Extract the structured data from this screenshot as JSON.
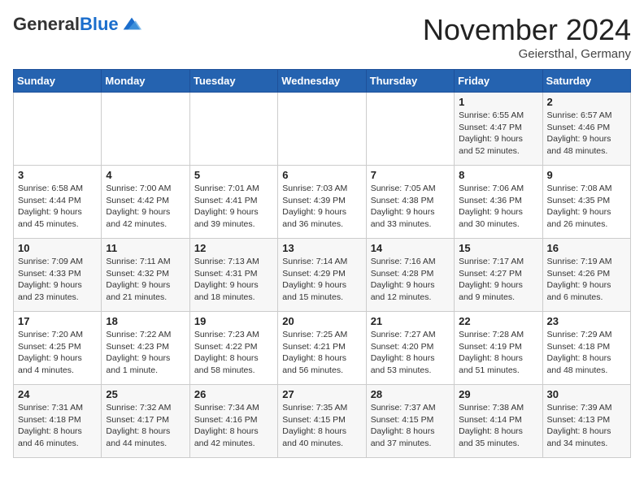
{
  "logo": {
    "general": "General",
    "blue": "Blue"
  },
  "header": {
    "month_title": "November 2024",
    "location": "Geiersthal, Germany"
  },
  "days_of_week": [
    "Sunday",
    "Monday",
    "Tuesday",
    "Wednesday",
    "Thursday",
    "Friday",
    "Saturday"
  ],
  "weeks": [
    [
      {
        "day": "",
        "info": ""
      },
      {
        "day": "",
        "info": ""
      },
      {
        "day": "",
        "info": ""
      },
      {
        "day": "",
        "info": ""
      },
      {
        "day": "",
        "info": ""
      },
      {
        "day": "1",
        "info": "Sunrise: 6:55 AM\nSunset: 4:47 PM\nDaylight: 9 hours\nand 52 minutes."
      },
      {
        "day": "2",
        "info": "Sunrise: 6:57 AM\nSunset: 4:46 PM\nDaylight: 9 hours\nand 48 minutes."
      }
    ],
    [
      {
        "day": "3",
        "info": "Sunrise: 6:58 AM\nSunset: 4:44 PM\nDaylight: 9 hours\nand 45 minutes."
      },
      {
        "day": "4",
        "info": "Sunrise: 7:00 AM\nSunset: 4:42 PM\nDaylight: 9 hours\nand 42 minutes."
      },
      {
        "day": "5",
        "info": "Sunrise: 7:01 AM\nSunset: 4:41 PM\nDaylight: 9 hours\nand 39 minutes."
      },
      {
        "day": "6",
        "info": "Sunrise: 7:03 AM\nSunset: 4:39 PM\nDaylight: 9 hours\nand 36 minutes."
      },
      {
        "day": "7",
        "info": "Sunrise: 7:05 AM\nSunset: 4:38 PM\nDaylight: 9 hours\nand 33 minutes."
      },
      {
        "day": "8",
        "info": "Sunrise: 7:06 AM\nSunset: 4:36 PM\nDaylight: 9 hours\nand 30 minutes."
      },
      {
        "day": "9",
        "info": "Sunrise: 7:08 AM\nSunset: 4:35 PM\nDaylight: 9 hours\nand 26 minutes."
      }
    ],
    [
      {
        "day": "10",
        "info": "Sunrise: 7:09 AM\nSunset: 4:33 PM\nDaylight: 9 hours\nand 23 minutes."
      },
      {
        "day": "11",
        "info": "Sunrise: 7:11 AM\nSunset: 4:32 PM\nDaylight: 9 hours\nand 21 minutes."
      },
      {
        "day": "12",
        "info": "Sunrise: 7:13 AM\nSunset: 4:31 PM\nDaylight: 9 hours\nand 18 minutes."
      },
      {
        "day": "13",
        "info": "Sunrise: 7:14 AM\nSunset: 4:29 PM\nDaylight: 9 hours\nand 15 minutes."
      },
      {
        "day": "14",
        "info": "Sunrise: 7:16 AM\nSunset: 4:28 PM\nDaylight: 9 hours\nand 12 minutes."
      },
      {
        "day": "15",
        "info": "Sunrise: 7:17 AM\nSunset: 4:27 PM\nDaylight: 9 hours\nand 9 minutes."
      },
      {
        "day": "16",
        "info": "Sunrise: 7:19 AM\nSunset: 4:26 PM\nDaylight: 9 hours\nand 6 minutes."
      }
    ],
    [
      {
        "day": "17",
        "info": "Sunrise: 7:20 AM\nSunset: 4:25 PM\nDaylight: 9 hours\nand 4 minutes."
      },
      {
        "day": "18",
        "info": "Sunrise: 7:22 AM\nSunset: 4:23 PM\nDaylight: 9 hours\nand 1 minute."
      },
      {
        "day": "19",
        "info": "Sunrise: 7:23 AM\nSunset: 4:22 PM\nDaylight: 8 hours\nand 58 minutes."
      },
      {
        "day": "20",
        "info": "Sunrise: 7:25 AM\nSunset: 4:21 PM\nDaylight: 8 hours\nand 56 minutes."
      },
      {
        "day": "21",
        "info": "Sunrise: 7:27 AM\nSunset: 4:20 PM\nDaylight: 8 hours\nand 53 minutes."
      },
      {
        "day": "22",
        "info": "Sunrise: 7:28 AM\nSunset: 4:19 PM\nDaylight: 8 hours\nand 51 minutes."
      },
      {
        "day": "23",
        "info": "Sunrise: 7:29 AM\nSunset: 4:18 PM\nDaylight: 8 hours\nand 48 minutes."
      }
    ],
    [
      {
        "day": "24",
        "info": "Sunrise: 7:31 AM\nSunset: 4:18 PM\nDaylight: 8 hours\nand 46 minutes."
      },
      {
        "day": "25",
        "info": "Sunrise: 7:32 AM\nSunset: 4:17 PM\nDaylight: 8 hours\nand 44 minutes."
      },
      {
        "day": "26",
        "info": "Sunrise: 7:34 AM\nSunset: 4:16 PM\nDaylight: 8 hours\nand 42 minutes."
      },
      {
        "day": "27",
        "info": "Sunrise: 7:35 AM\nSunset: 4:15 PM\nDaylight: 8 hours\nand 40 minutes."
      },
      {
        "day": "28",
        "info": "Sunrise: 7:37 AM\nSunset: 4:15 PM\nDaylight: 8 hours\nand 37 minutes."
      },
      {
        "day": "29",
        "info": "Sunrise: 7:38 AM\nSunset: 4:14 PM\nDaylight: 8 hours\nand 35 minutes."
      },
      {
        "day": "30",
        "info": "Sunrise: 7:39 AM\nSunset: 4:13 PM\nDaylight: 8 hours\nand 34 minutes."
      }
    ]
  ]
}
